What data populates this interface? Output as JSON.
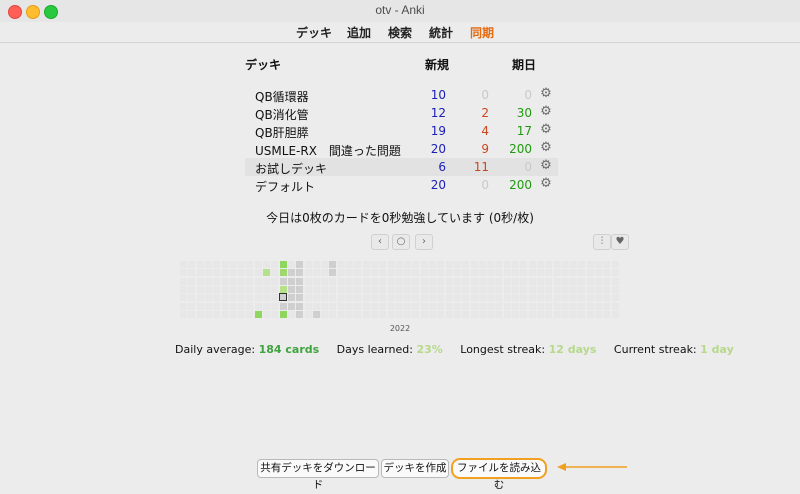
{
  "window": {
    "title": "otv - Anki"
  },
  "toolbar": {
    "items": [
      "デッキ",
      "追加",
      "検索",
      "統計",
      "同期"
    ]
  },
  "deck_list": {
    "headers": {
      "deck": "デッキ",
      "new": "新規",
      "due": "期日"
    },
    "rows": [
      {
        "name": "QB循環器",
        "new": "10",
        "learn": "0",
        "due": "0"
      },
      {
        "name": "QB消化管",
        "new": "12",
        "learn": "2",
        "due": "30"
      },
      {
        "name": "QB肝胆膵",
        "new": "19",
        "learn": "4",
        "due": "17"
      },
      {
        "name": "USMLE-RX　間違った問題",
        "new": "20",
        "learn": "9",
        "due": "200"
      },
      {
        "name": "お試しデッキ",
        "new": "6",
        "learn": "11",
        "due": "0"
      },
      {
        "name": "デフォルト",
        "new": "20",
        "learn": "0",
        "due": "200"
      }
    ]
  },
  "studied_today": "今日は0枚のカードを0秒勉強しています (0秒/枚)",
  "heatmap": {
    "year": "2022",
    "nav": {
      "prev": "‹",
      "today": "○",
      "next": "›"
    }
  },
  "stats": {
    "daily_average_label": "Daily average:",
    "daily_average_value": "184 cards",
    "days_learned_label": "Days learned:",
    "days_learned_value": "23%",
    "longest_streak_label": "Longest streak:",
    "longest_streak_value": "12 days",
    "current_streak_label": "Current streak:",
    "current_streak_value": "1 day"
  },
  "buttons": {
    "download": "共有デッキをダウンロード",
    "create": "デッキを作成",
    "import": "ファイルを読み込む"
  },
  "colors": {
    "sync": "#e36b12",
    "new": "#1c20b5",
    "learn": "#c9471e",
    "due": "#1f9a0f",
    "accent_ring": "#f2a01f"
  }
}
